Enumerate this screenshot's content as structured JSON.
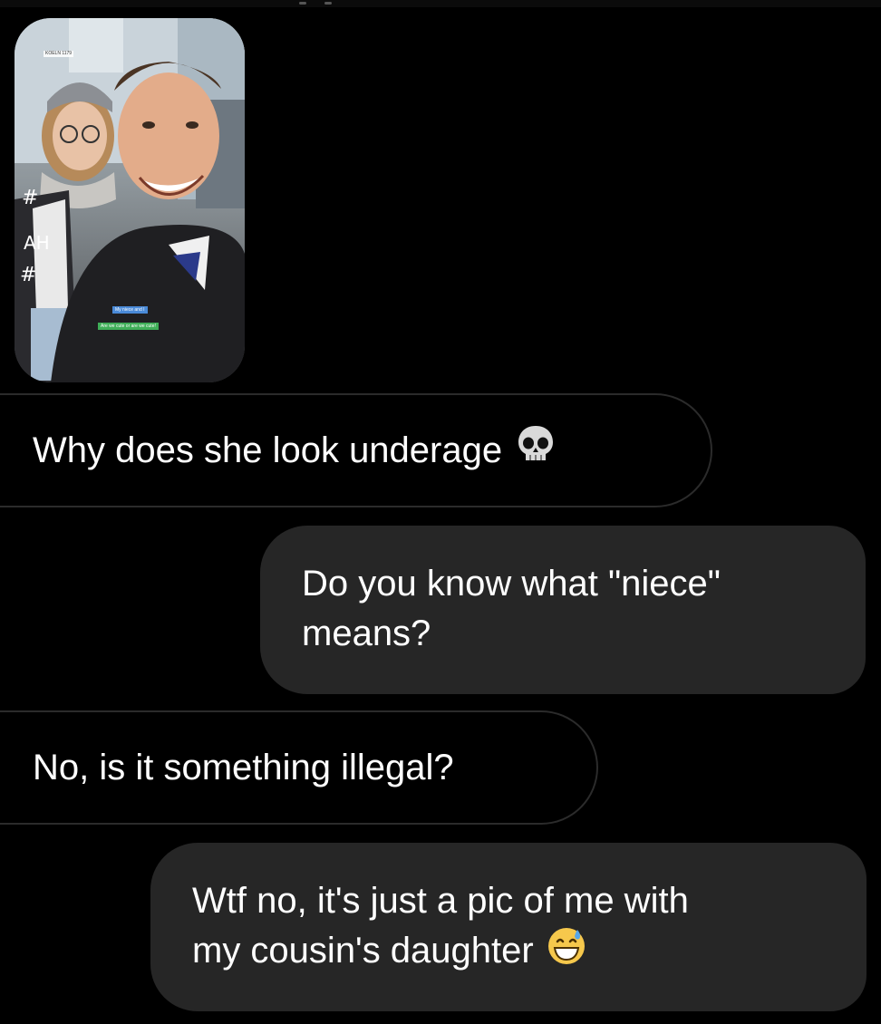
{
  "conversation": {
    "shared_photo": {
      "sticker_line_1": "My niece and I",
      "sticker_line_2": "Are we cute or are we cute!",
      "stamp": "KOELN 1179"
    },
    "messages": [
      {
        "side": "received",
        "text": "Why does she look underage",
        "emoji": "skull-emoji"
      },
      {
        "side": "sent",
        "line1": "Do you know what \"niece\"",
        "line2": "means?"
      },
      {
        "side": "received",
        "text": "No, is it something illegal?"
      },
      {
        "side": "sent",
        "line1": "Wtf no, it's just a pic of me with",
        "line2": "my cousin's daughter",
        "emoji": "grinning-sweat-emoji"
      }
    ]
  },
  "colors": {
    "background": "#000000",
    "sent_bubble": "#262626",
    "received_border": "#2b2b2b",
    "text": "#ffffff"
  }
}
